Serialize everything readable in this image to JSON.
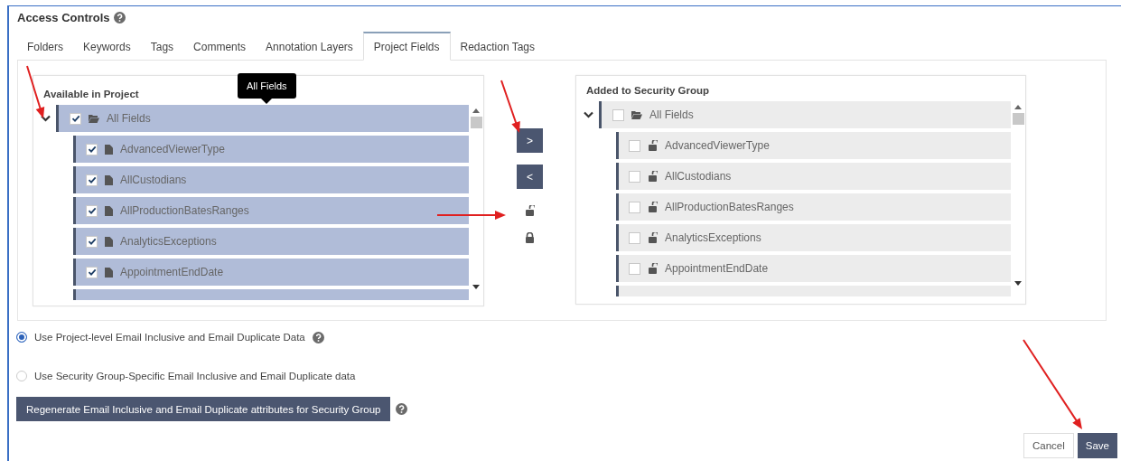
{
  "title": "Access Controls",
  "tabs": [
    {
      "label": "Folders",
      "selected": false
    },
    {
      "label": "Keywords",
      "selected": false
    },
    {
      "label": "Tags",
      "selected": false
    },
    {
      "label": "Comments",
      "selected": false
    },
    {
      "label": "Annotation Layers",
      "selected": false
    },
    {
      "label": "Project Fields",
      "selected": true
    },
    {
      "label": "Redaction Tags",
      "selected": false
    }
  ],
  "available": {
    "heading": "Available in Project",
    "tooltip": "All Fields",
    "root": {
      "label": "All Fields",
      "checked": true,
      "expanded": true,
      "children": [
        {
          "label": "AdvancedViewerType",
          "checked": true
        },
        {
          "label": "AllCustodians",
          "checked": true
        },
        {
          "label": "AllProductionBatesRanges",
          "checked": true
        },
        {
          "label": "AnalyticsExceptions",
          "checked": true
        },
        {
          "label": "AppointmentEndDate",
          "checked": true
        }
      ]
    }
  },
  "move_buttons": [
    {
      "label": ">"
    },
    {
      "label": "<"
    }
  ],
  "lock_buttons": [
    {
      "locked": false
    },
    {
      "locked": true
    }
  ],
  "added": {
    "heading": "Added to Security Group",
    "root": {
      "label": "All Fields",
      "checked": false,
      "expanded": true,
      "children": [
        {
          "label": "AdvancedViewerType",
          "checked": false,
          "locked": false
        },
        {
          "label": "AllCustodians",
          "checked": false,
          "locked": false
        },
        {
          "label": "AllProductionBatesRanges",
          "checked": false,
          "locked": false
        },
        {
          "label": "AnalyticsExceptions",
          "checked": false,
          "locked": false
        },
        {
          "label": "AppointmentEndDate",
          "checked": false,
          "locked": false
        }
      ]
    }
  },
  "radios": [
    {
      "label": "Use Project-level Email Inclusive and Email Duplicate Data",
      "selected": true,
      "help": true
    },
    {
      "label": "Use Security Group-Specific Email Inclusive and Email Duplicate data",
      "selected": false,
      "help": false
    }
  ],
  "regenerate_button": "Regenerate Email Inclusive and Email Duplicate attributes for Security Group",
  "cancel_button": "Cancel",
  "save_button": "Save"
}
